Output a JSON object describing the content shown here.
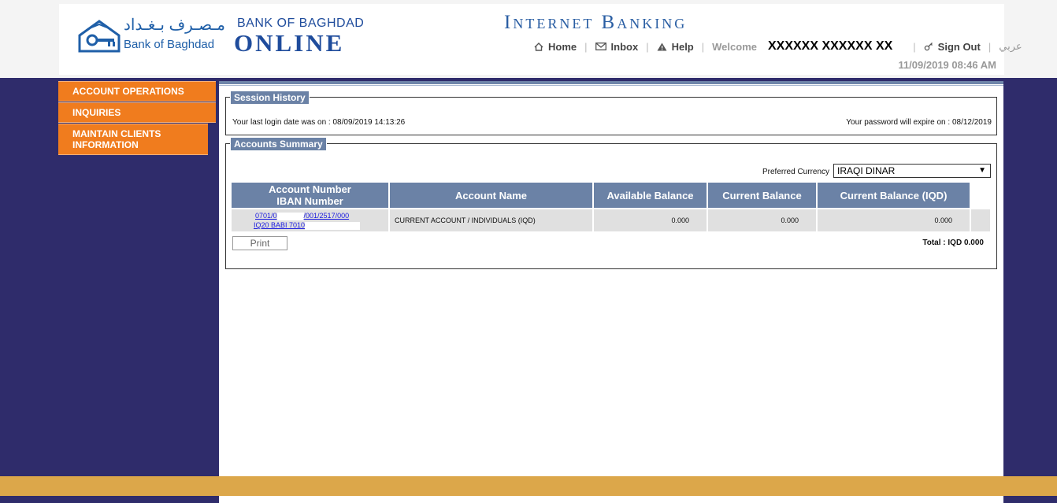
{
  "header": {
    "logo_arabic": "مـصـرف بـغـداد",
    "logo_english": "Bank of Baghdad",
    "brand_top": "BANK OF BAGHDAD",
    "brand_main": "ONLINE",
    "title": "Internet Banking",
    "nav": {
      "home": "Home",
      "inbox": "Inbox",
      "help": "Help",
      "welcome": "Welcome",
      "user": "XXXXXX XXXXXX XX",
      "signout": "Sign Out",
      "lang": "عربي"
    },
    "datetime": "11/09/2019 08:46 AM"
  },
  "sidebar": {
    "items": [
      {
        "label": "ACCOUNT OPERATIONS"
      },
      {
        "label": "INQUIRIES"
      },
      {
        "label": "MAINTAIN CLIENTS INFORMATION"
      }
    ]
  },
  "session": {
    "legend": "Session History",
    "last_login": "Your last login date was on : 08/09/2019 14:13:26",
    "password_expire": "Your password will expire on : 08/12/2019"
  },
  "accounts": {
    "legend": "Accounts Summary",
    "preferred_label": "Preferred Currency",
    "preferred_value": "IRAQI DINAR",
    "headers": {
      "number_line1": "Account Number",
      "number_line2": "IBAN Number",
      "name": "Account Name",
      "available": "Available Balance",
      "current": "Current Balance",
      "current_iqd": "Current Balance (IQD)"
    },
    "rows": [
      {
        "number_a": "0701/0",
        "number_b": "/001/2517/000",
        "iban": "IQ20 BABI 7010",
        "name": "CURRENT ACCOUNT / INDIVIDUALS (IQD)",
        "available": "0.000",
        "current": "0.000",
        "current_iqd": "0.000"
      }
    ],
    "print_label": "Print",
    "total": "Total : IQD 0.000"
  },
  "colors": {
    "navy": "#2f2c6b",
    "orange": "#f07c1e",
    "header_blue": "#6b82a6",
    "gold": "#dca74a"
  }
}
